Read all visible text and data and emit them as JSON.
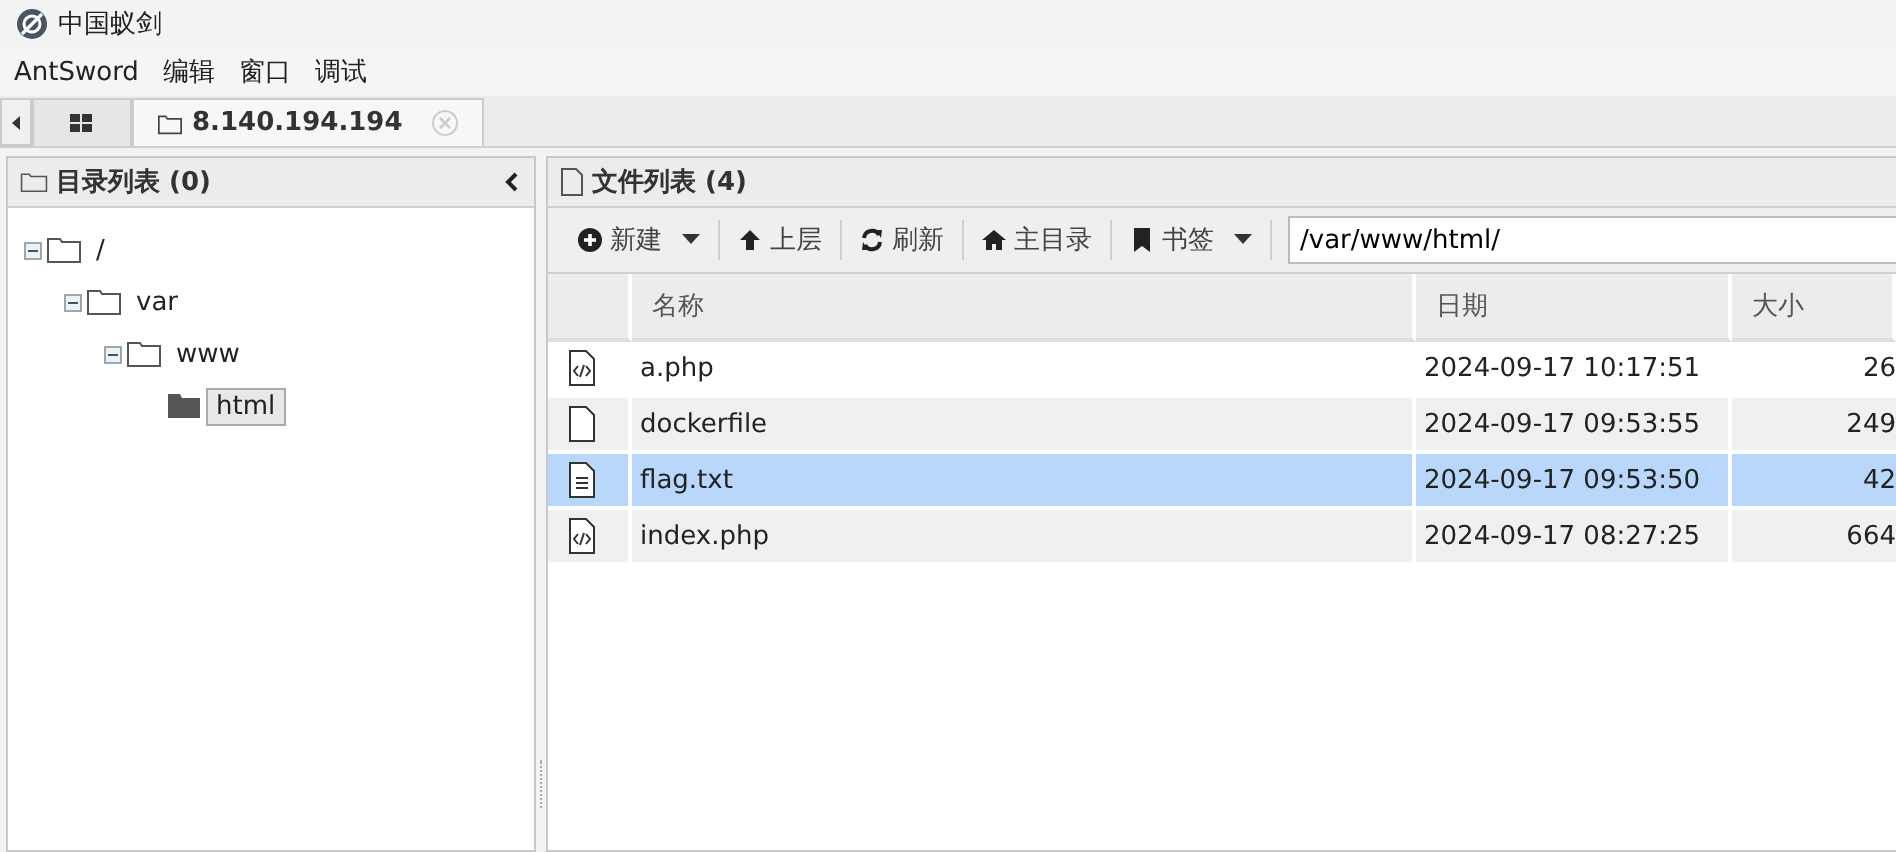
{
  "window": {
    "title": "中国蚁剑"
  },
  "menu": [
    "AntSword",
    "编辑",
    "窗口",
    "调试"
  ],
  "tabs": [
    {
      "kind": "home",
      "selected": false
    },
    {
      "kind": "folder",
      "label": "8.140.194.194",
      "selected": true
    }
  ],
  "sidebar": {
    "title": "目录列表 (0)",
    "tree": [
      {
        "label": "/",
        "expanded": true,
        "selected": false,
        "children": [
          {
            "label": "var",
            "expanded": true,
            "selected": false,
            "children": [
              {
                "label": "www",
                "expanded": true,
                "selected": false,
                "children": [
                  {
                    "label": "html",
                    "selected": true
                  }
                ]
              }
            ]
          }
        ]
      }
    ]
  },
  "files": {
    "title": "文件列表 (4)",
    "toolbar": [
      {
        "kind": "new",
        "label": "新建",
        "dropdown": true
      },
      {
        "kind": "up",
        "label": "上层",
        "dropdown": false
      },
      {
        "kind": "refresh",
        "label": "刷新",
        "dropdown": false
      },
      {
        "kind": "home",
        "label": "主目录",
        "dropdown": false
      },
      {
        "kind": "bookmark",
        "label": "书签",
        "dropdown": true
      }
    ],
    "path": "/var/www/html/",
    "columns": [
      "名称",
      "日期",
      "大小"
    ],
    "rows": [
      {
        "kind": "code",
        "name": "a.php",
        "date": "2024-09-17 10:17:51",
        "size": "26",
        "selected": false
      },
      {
        "kind": "file",
        "name": "dockerfile",
        "date": "2024-09-17 09:53:55",
        "size": "249",
        "selected": false
      },
      {
        "kind": "text",
        "name": "flag.txt",
        "date": "2024-09-17 09:53:50",
        "size": "42",
        "selected": true
      },
      {
        "kind": "code",
        "name": "index.php",
        "date": "2024-09-17 08:27:25",
        "size": "664",
        "selected": false
      }
    ]
  }
}
